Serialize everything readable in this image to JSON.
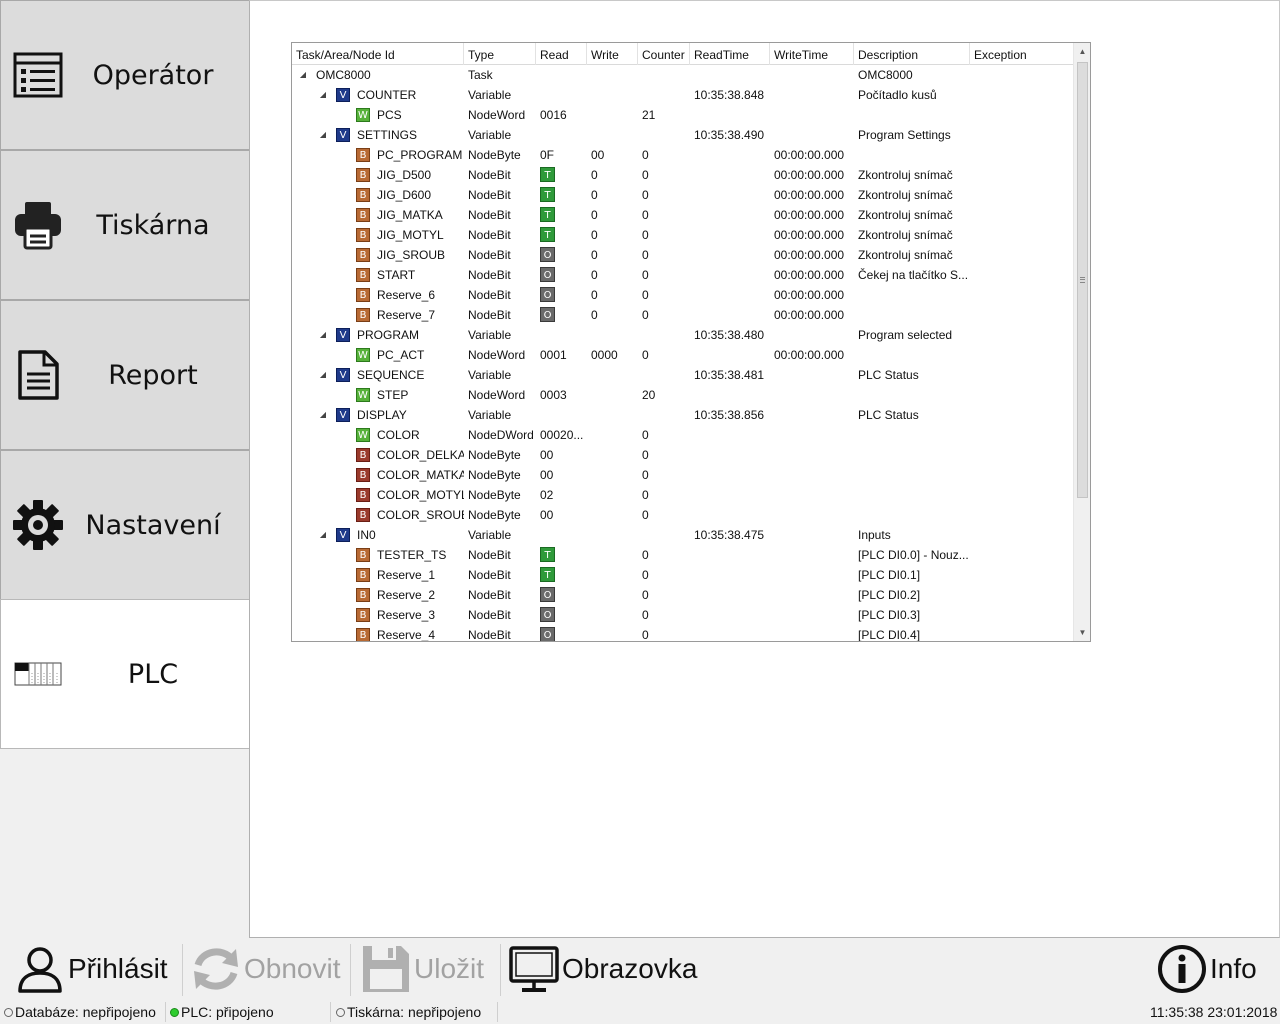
{
  "sidebar": {
    "items": [
      {
        "label": "Operátor",
        "icon": "list-form-icon",
        "active": false
      },
      {
        "label": "Tiskárna",
        "icon": "printer-icon",
        "active": false
      },
      {
        "label": "Report",
        "icon": "document-icon",
        "active": false
      },
      {
        "label": "Nastavení",
        "icon": "gear-icon",
        "active": false
      },
      {
        "label": "PLC",
        "icon": "plc-rack-icon",
        "active": true
      }
    ]
  },
  "tree": {
    "columns": [
      "Task/Area/Node Id",
      "Type",
      "Read",
      "Write",
      "Counter",
      "ReadTime",
      "WriteTime",
      "Description",
      "Exception"
    ],
    "rows": [
      {
        "level": 0,
        "expanded": true,
        "badge": "",
        "name": "OMC8000",
        "type": "Task",
        "read": "",
        "bit": "",
        "write": "",
        "counter": "",
        "readtime": "",
        "writetime": "",
        "description": "OMC8000",
        "exception": ""
      },
      {
        "level": 1,
        "expanded": true,
        "badge": "V",
        "name": "COUNTER",
        "type": "Variable",
        "read": "",
        "bit": "",
        "write": "",
        "counter": "",
        "readtime": "10:35:38.848",
        "writetime": "",
        "description": "Počítadlo kusů",
        "exception": ""
      },
      {
        "level": 2,
        "expanded": null,
        "badge": "W",
        "name": "PCS",
        "type": "NodeWord",
        "read": "0016",
        "bit": "",
        "write": "",
        "counter": "21",
        "readtime": "",
        "writetime": "",
        "description": "",
        "exception": ""
      },
      {
        "level": 1,
        "expanded": true,
        "badge": "V",
        "name": "SETTINGS",
        "type": "Variable",
        "read": "",
        "bit": "",
        "write": "",
        "counter": "",
        "readtime": "10:35:38.490",
        "writetime": "",
        "description": "Program Settings",
        "exception": ""
      },
      {
        "level": 2,
        "expanded": null,
        "badge": "B",
        "name": "PC_PROGRAM",
        "type": "NodeByte",
        "read": "0F",
        "bit": "",
        "write": "00",
        "counter": "0",
        "readtime": "",
        "writetime": "00:00:00.000",
        "description": "",
        "exception": ""
      },
      {
        "level": 2,
        "expanded": null,
        "badge": "B",
        "name": "JIG_D500",
        "type": "NodeBit",
        "read": "",
        "bit": "T",
        "write": "0",
        "counter": "0",
        "readtime": "",
        "writetime": "00:00:00.000",
        "description": "Zkontroluj snímač",
        "exception": ""
      },
      {
        "level": 2,
        "expanded": null,
        "badge": "B",
        "name": "JIG_D600",
        "type": "NodeBit",
        "read": "",
        "bit": "T",
        "write": "0",
        "counter": "0",
        "readtime": "",
        "writetime": "00:00:00.000",
        "description": "Zkontroluj snímač",
        "exception": ""
      },
      {
        "level": 2,
        "expanded": null,
        "badge": "B",
        "name": "JIG_MATKA",
        "type": "NodeBit",
        "read": "",
        "bit": "T",
        "write": "0",
        "counter": "0",
        "readtime": "",
        "writetime": "00:00:00.000",
        "description": "Zkontroluj snímač",
        "exception": ""
      },
      {
        "level": 2,
        "expanded": null,
        "badge": "B",
        "name": "JIG_MOTYL",
        "type": "NodeBit",
        "read": "",
        "bit": "T",
        "write": "0",
        "counter": "0",
        "readtime": "",
        "writetime": "00:00:00.000",
        "description": "Zkontroluj snímač",
        "exception": ""
      },
      {
        "level": 2,
        "expanded": null,
        "badge": "B",
        "name": "JIG_SROUB",
        "type": "NodeBit",
        "read": "",
        "bit": "O",
        "write": "0",
        "counter": "0",
        "readtime": "",
        "writetime": "00:00:00.000",
        "description": "Zkontroluj snímač",
        "exception": ""
      },
      {
        "level": 2,
        "expanded": null,
        "badge": "B",
        "name": "START",
        "type": "NodeBit",
        "read": "",
        "bit": "O",
        "write": "0",
        "counter": "0",
        "readtime": "",
        "writetime": "00:00:00.000",
        "description": "Čekej na tlačítko S...",
        "exception": ""
      },
      {
        "level": 2,
        "expanded": null,
        "badge": "B",
        "name": "Reserve_6",
        "type": "NodeBit",
        "read": "",
        "bit": "O",
        "write": "0",
        "counter": "0",
        "readtime": "",
        "writetime": "00:00:00.000",
        "description": "",
        "exception": ""
      },
      {
        "level": 2,
        "expanded": null,
        "badge": "B",
        "name": "Reserve_7",
        "type": "NodeBit",
        "read": "",
        "bit": "O",
        "write": "0",
        "counter": "0",
        "readtime": "",
        "writetime": "00:00:00.000",
        "description": "",
        "exception": ""
      },
      {
        "level": 1,
        "expanded": true,
        "badge": "V",
        "name": "PROGRAM",
        "type": "Variable",
        "read": "",
        "bit": "",
        "write": "",
        "counter": "",
        "readtime": "10:35:38.480",
        "writetime": "",
        "description": "Program selected",
        "exception": ""
      },
      {
        "level": 2,
        "expanded": null,
        "badge": "W",
        "name": "PC_ACT",
        "type": "NodeWord",
        "read": "0001",
        "bit": "",
        "write": "0000",
        "counter": "0",
        "readtime": "",
        "writetime": "00:00:00.000",
        "description": "",
        "exception": ""
      },
      {
        "level": 1,
        "expanded": true,
        "badge": "V",
        "name": "SEQUENCE",
        "type": "Variable",
        "read": "",
        "bit": "",
        "write": "",
        "counter": "",
        "readtime": "10:35:38.481",
        "writetime": "",
        "description": "PLC Status",
        "exception": ""
      },
      {
        "level": 2,
        "expanded": null,
        "badge": "W",
        "name": "STEP",
        "type": "NodeWord",
        "read": "0003",
        "bit": "",
        "write": "",
        "counter": "20",
        "readtime": "",
        "writetime": "",
        "description": "",
        "exception": ""
      },
      {
        "level": 1,
        "expanded": true,
        "badge": "V",
        "name": "DISPLAY",
        "type": "Variable",
        "read": "",
        "bit": "",
        "write": "",
        "counter": "",
        "readtime": "10:35:38.856",
        "writetime": "",
        "description": "PLC Status",
        "exception": ""
      },
      {
        "level": 2,
        "expanded": null,
        "badge": "W",
        "name": "COLOR",
        "type": "NodeDWord",
        "read": "00020...",
        "bit": "",
        "write": "",
        "counter": "0",
        "readtime": "",
        "writetime": "",
        "description": "",
        "exception": ""
      },
      {
        "level": 2,
        "expanded": null,
        "badge": "Bd",
        "name": "COLOR_DELKA",
        "type": "NodeByte",
        "read": "00",
        "bit": "",
        "write": "",
        "counter": "0",
        "readtime": "",
        "writetime": "",
        "description": "",
        "exception": ""
      },
      {
        "level": 2,
        "expanded": null,
        "badge": "Bd",
        "name": "COLOR_MATKA",
        "type": "NodeByte",
        "read": "00",
        "bit": "",
        "write": "",
        "counter": "0",
        "readtime": "",
        "writetime": "",
        "description": "",
        "exception": ""
      },
      {
        "level": 2,
        "expanded": null,
        "badge": "Bd",
        "name": "COLOR_MOTYL",
        "type": "NodeByte",
        "read": "02",
        "bit": "",
        "write": "",
        "counter": "0",
        "readtime": "",
        "writetime": "",
        "description": "",
        "exception": ""
      },
      {
        "level": 2,
        "expanded": null,
        "badge": "Bd",
        "name": "COLOR_SROUB",
        "type": "NodeByte",
        "read": "00",
        "bit": "",
        "write": "",
        "counter": "0",
        "readtime": "",
        "writetime": "",
        "description": "",
        "exception": ""
      },
      {
        "level": 1,
        "expanded": true,
        "badge": "V",
        "name": "IN0",
        "type": "Variable",
        "read": "",
        "bit": "",
        "write": "",
        "counter": "",
        "readtime": "10:35:38.475",
        "writetime": "",
        "description": "Inputs",
        "exception": ""
      },
      {
        "level": 2,
        "expanded": null,
        "badge": "B",
        "name": "TESTER_TS",
        "type": "NodeBit",
        "read": "",
        "bit": "T",
        "write": "",
        "counter": "0",
        "readtime": "",
        "writetime": "",
        "description": "[PLC DI0.0] - Nouz...",
        "exception": ""
      },
      {
        "level": 2,
        "expanded": null,
        "badge": "B",
        "name": "Reserve_1",
        "type": "NodeBit",
        "read": "",
        "bit": "T",
        "write": "",
        "counter": "0",
        "readtime": "",
        "writetime": "",
        "description": "[PLC DI0.1]",
        "exception": ""
      },
      {
        "level": 2,
        "expanded": null,
        "badge": "B",
        "name": "Reserve_2",
        "type": "NodeBit",
        "read": "",
        "bit": "O",
        "write": "",
        "counter": "0",
        "readtime": "",
        "writetime": "",
        "description": "[PLC DI0.2]",
        "exception": ""
      },
      {
        "level": 2,
        "expanded": null,
        "badge": "B",
        "name": "Reserve_3",
        "type": "NodeBit",
        "read": "",
        "bit": "O",
        "write": "",
        "counter": "0",
        "readtime": "",
        "writetime": "",
        "description": "[PLC DI0.3]",
        "exception": ""
      },
      {
        "level": 2,
        "expanded": null,
        "badge": "B",
        "name": "Reserve_4",
        "type": "NodeBit",
        "read": "",
        "bit": "O",
        "write": "",
        "counter": "0",
        "readtime": "",
        "writetime": "",
        "description": "[PLC DI0.4]",
        "exception": ""
      }
    ]
  },
  "toolbar": {
    "login_label": "Přihlásit",
    "refresh_label": "Obnovit",
    "save_label": "Uložit",
    "screen_label": "Obrazovka",
    "info_label": "Info"
  },
  "status": {
    "database": "Databáze: nepřipojeno",
    "plc": "PLC: připojeno",
    "printer": "Tiskárna: nepřipojeno",
    "datetime": "11:35:38 23:01:2018"
  },
  "colors": {
    "badge_variable": "#1f3a8a",
    "badge_word": "#56b13a",
    "badge_bit": "#b86a34",
    "bit_true": "#2f9a3a",
    "bit_off": "#6a6a6a",
    "status_connected": "#2ecc2e"
  }
}
